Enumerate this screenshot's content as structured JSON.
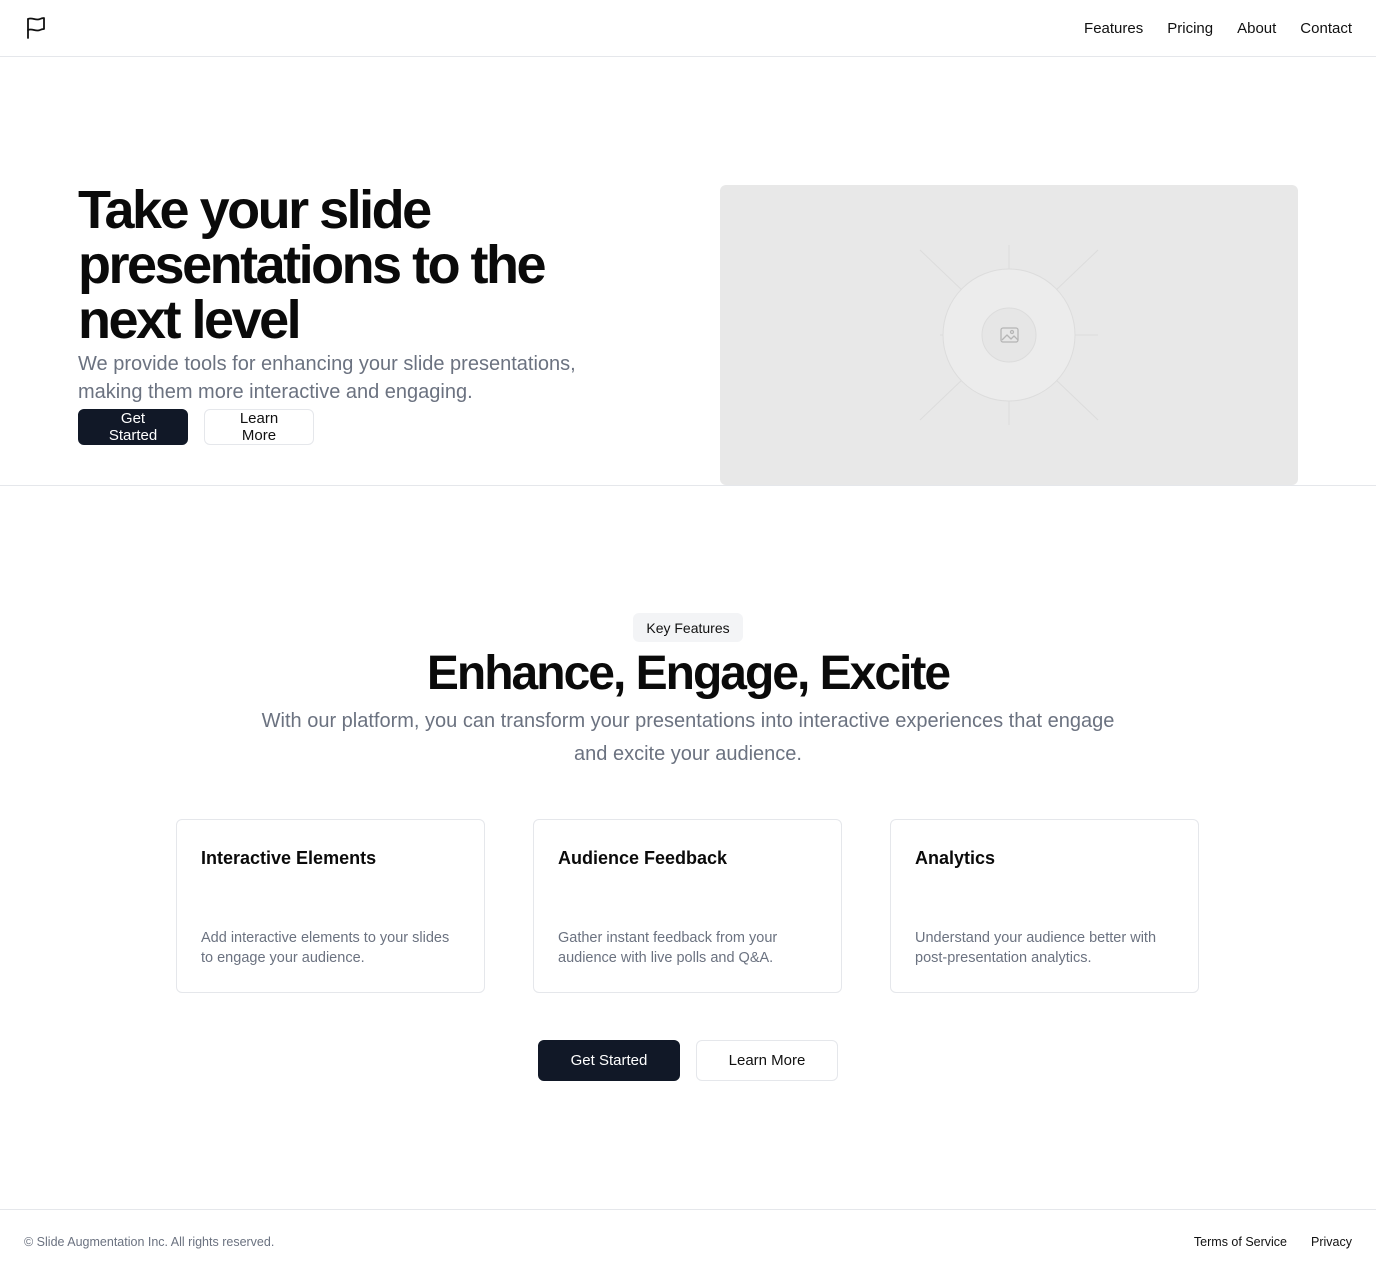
{
  "header": {
    "logo_icon": "flag-icon",
    "nav": [
      {
        "label": "Features"
      },
      {
        "label": "Pricing"
      },
      {
        "label": "About"
      },
      {
        "label": "Contact"
      }
    ]
  },
  "hero": {
    "title": "Take your slide presentations to the next level",
    "subtitle": "We provide tools for enhancing your slide presentations, making them more interactive and engaging.",
    "primary_button": "Get Started",
    "secondary_button": "Learn More",
    "image_icon": "image-placeholder-icon"
  },
  "features": {
    "badge": "Key Features",
    "title": "Enhance, Engage, Excite",
    "subtitle": "With our platform, you can transform your presentations into interactive experiences that engage and excite your audience.",
    "cards": [
      {
        "title": "Interactive Elements",
        "description": "Add interactive elements to your slides to engage your audience."
      },
      {
        "title": "Audience Feedback",
        "description": "Gather instant feedback from your audience with live polls and Q&A."
      },
      {
        "title": "Analytics",
        "description": "Understand your audience better with post-presentation analytics."
      }
    ],
    "primary_button": "Get Started",
    "secondary_button": "Learn More"
  },
  "footer": {
    "copyright": "© Slide Augmentation Inc. All rights reserved.",
    "links": [
      {
        "label": "Terms of Service"
      },
      {
        "label": "Privacy"
      }
    ]
  },
  "colors": {
    "primary_button_bg": "#111827",
    "muted_text": "#6b7280",
    "border": "#e5e7eb",
    "placeholder_bg": "#e8e8e8"
  }
}
